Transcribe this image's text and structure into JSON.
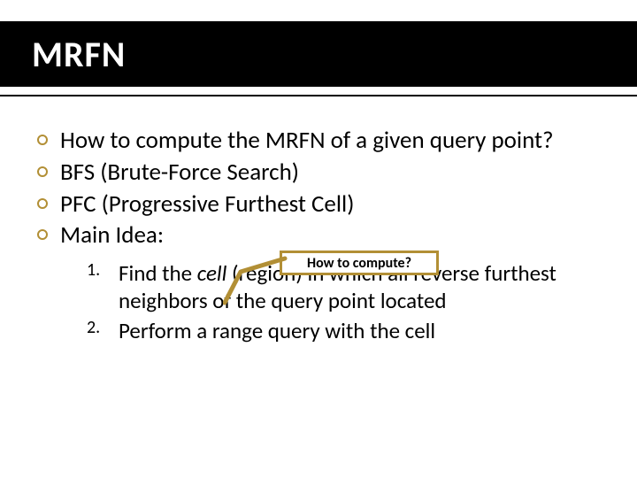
{
  "title": "MRFN",
  "bullets": {
    "b1": "How to compute the MRFN of a given query point?",
    "b2": "BFS (Brute-Force Search)",
    "b3": "PFC (Progressive  Furthest Cell)",
    "b4": "Main Idea:"
  },
  "callout": "How to compute?",
  "steps": {
    "s1_pre": "Find the ",
    "s1_em": "cell",
    "s1_post": " (region) in which all reverse furthest neighbors of the query point located",
    "s2": "Perform a range query with the cell"
  },
  "accent_color": "#b28f35"
}
